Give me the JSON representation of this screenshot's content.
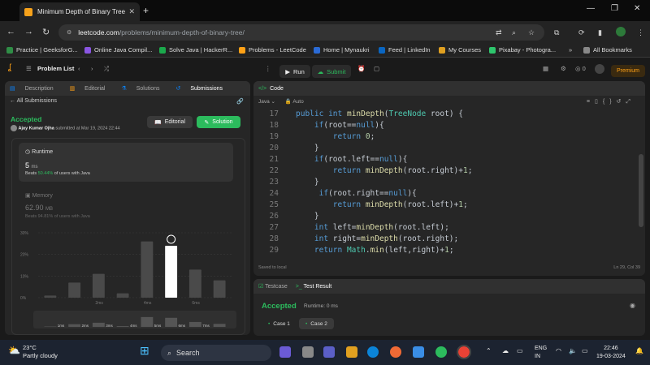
{
  "browser": {
    "tab_title": "Minimum Depth of Binary Tree",
    "url_domain": "leetcode.com",
    "url_path": "/problems/minimum-depth-of-binary-tree/",
    "bookmarks": [
      "Practice | GeeksforG...",
      "Online Java Compil...",
      "Solve Java | HackerR...",
      "Problems - LeetCode",
      "Home | Mynaukri",
      "Feed | LinkedIn",
      "My Courses",
      "Pixabay - Photogra..."
    ],
    "all_bookmarks": "All Bookmarks"
  },
  "lc_nav": {
    "problem_list": "Problem List",
    "run": "Run",
    "submit": "Submit",
    "premium": "Premium",
    "coins": "0"
  },
  "left": {
    "tabs": [
      "Description",
      "Editorial",
      "Solutions",
      "Submissions"
    ],
    "all_submissions": "All Submissions",
    "status": "Accepted",
    "author": "Ajay Kumar Ojha",
    "submitted": "submitted at Mar 19, 2024 22:44",
    "editorial_btn": "Editorial",
    "solution_btn": "Solution",
    "runtime_label": "Runtime",
    "runtime_value": "5",
    "runtime_unit": "ms",
    "runtime_beats_pre": "Beats",
    "runtime_beats_pct": "50.44%",
    "runtime_beats_post": "of users with Java",
    "memory_label": "Memory",
    "memory_value": "62.90",
    "memory_unit": "MB",
    "memory_beats": "Beats 94.81% of users with Java"
  },
  "chart_data": {
    "type": "bar",
    "ytick_labels": [
      "30%",
      "20%",
      "10%",
      "0%"
    ],
    "ylim": [
      0,
      30
    ],
    "values": [
      1,
      7,
      11,
      2,
      26,
      24,
      13,
      8
    ],
    "highlight_index": 5,
    "xtick_labels": [
      "2ms",
      "4ms",
      "6ms"
    ],
    "mini_labels": [
      "1ms",
      "2ms",
      "3ms",
      "4ms",
      "5ms",
      "6ms",
      "7ms"
    ]
  },
  "editor": {
    "title": "Code",
    "language": "Java",
    "mode": "Auto",
    "saved": "Saved to local",
    "position": "Ln 29, Col 39",
    "lines": [
      {
        "n": "17",
        "t": "    public int minDepth(TreeNode root) {"
      },
      {
        "n": "18",
        "t": "        if(root==null){"
      },
      {
        "n": "19",
        "t": "            return 0;"
      },
      {
        "n": "20",
        "t": "        }"
      },
      {
        "n": "21",
        "t": "        if(root.left==null){"
      },
      {
        "n": "22",
        "t": "            return minDepth(root.right)+1;"
      },
      {
        "n": "23",
        "t": "        }"
      },
      {
        "n": "24",
        "t": "         if(root.right==null){"
      },
      {
        "n": "25",
        "t": "            return minDepth(root.left)+1;"
      },
      {
        "n": "26",
        "t": "        }"
      },
      {
        "n": "27",
        "t": "        int left=minDepth(root.left);"
      },
      {
        "n": "28",
        "t": "        int right=minDepth(root.right);"
      },
      {
        "n": "29",
        "t": "        return Math.min(left,right)+1;"
      }
    ]
  },
  "test": {
    "tab1": "Testcase",
    "tab2": "Test Result",
    "status": "Accepted",
    "runtime": "Runtime: 0 ms",
    "case1": "Case 1",
    "case2": "Case 2"
  },
  "taskbar": {
    "temp": "23°C",
    "weather": "Partly cloudy",
    "search": "Search",
    "lang1": "ENG",
    "lang2": "IN",
    "time": "22:46",
    "date": "19-03-2024"
  }
}
